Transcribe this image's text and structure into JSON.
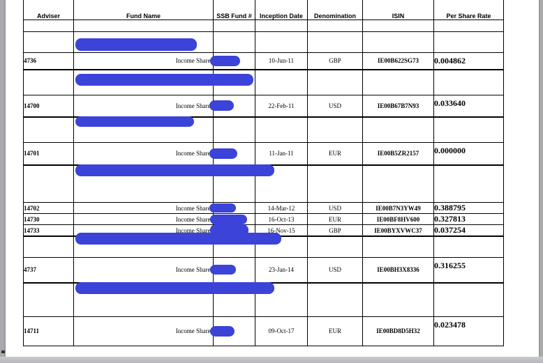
{
  "headers": {
    "adviser": "Adviser",
    "fund_name": "Fund Name",
    "ssb": "SSB Fund #",
    "inception": "Inception Date",
    "denomination": "Denomination",
    "isin": "ISIN",
    "rate": "Per Share Rate"
  },
  "groups": [
    {
      "rows": [
        {
          "adviser": "4736",
          "fund": "Income Shares",
          "date": "10-Jun-11",
          "denomination": "GBP",
          "isin": "IE00B622SG73",
          "rate": "0.004862"
        }
      ]
    },
    {
      "rows": [
        {
          "adviser": "14700",
          "fund": "Income Shares",
          "date": "22-Feb-11",
          "denomination": "USD",
          "isin": "IE00B67B7N93",
          "rate": "0.033640"
        }
      ]
    },
    {
      "rows": [
        {
          "adviser": "14701",
          "fund": "Income Shares",
          "date": "11-Jan-11",
          "denomination": "EUR",
          "isin": "IE00B5ZR2157",
          "rate": "0.000000"
        }
      ]
    },
    {
      "rows": [
        {
          "adviser": "14702",
          "fund": "Income Shares",
          "date": "14-Mar-12",
          "denomination": "USD",
          "isin": "IE00B7N3YW49",
          "rate": "0.388795"
        },
        {
          "adviser": "14730",
          "fund": "Income Shares",
          "date": "16-Oct-13",
          "denomination": "EUR",
          "isin": "IE00BF8HV600",
          "rate": "0.327813"
        },
        {
          "adviser": "14733",
          "fund": "Income Shares",
          "date": "16-Nov-15",
          "denomination": "GBP",
          "isin": "IE00BYXVWC37",
          "rate": "0.037254"
        }
      ]
    },
    {
      "rows": [
        {
          "adviser": "4737",
          "fund": "Income Shares",
          "date": "23-Jan-14",
          "denomination": "USD",
          "isin": "IE00BH3X8336",
          "rate": "0.316255"
        }
      ]
    },
    {
      "rows": [
        {
          "adviser": "14711",
          "fund": "Income Shares",
          "date": "09-Oct-17",
          "denomination": "EUR",
          "isin": "IE00BD8D5H32",
          "rate": "0.023478"
        }
      ]
    }
  ],
  "colors": {
    "redaction": "#3b43d8",
    "frame": "#a9aaad",
    "page": "#ffffff"
  }
}
